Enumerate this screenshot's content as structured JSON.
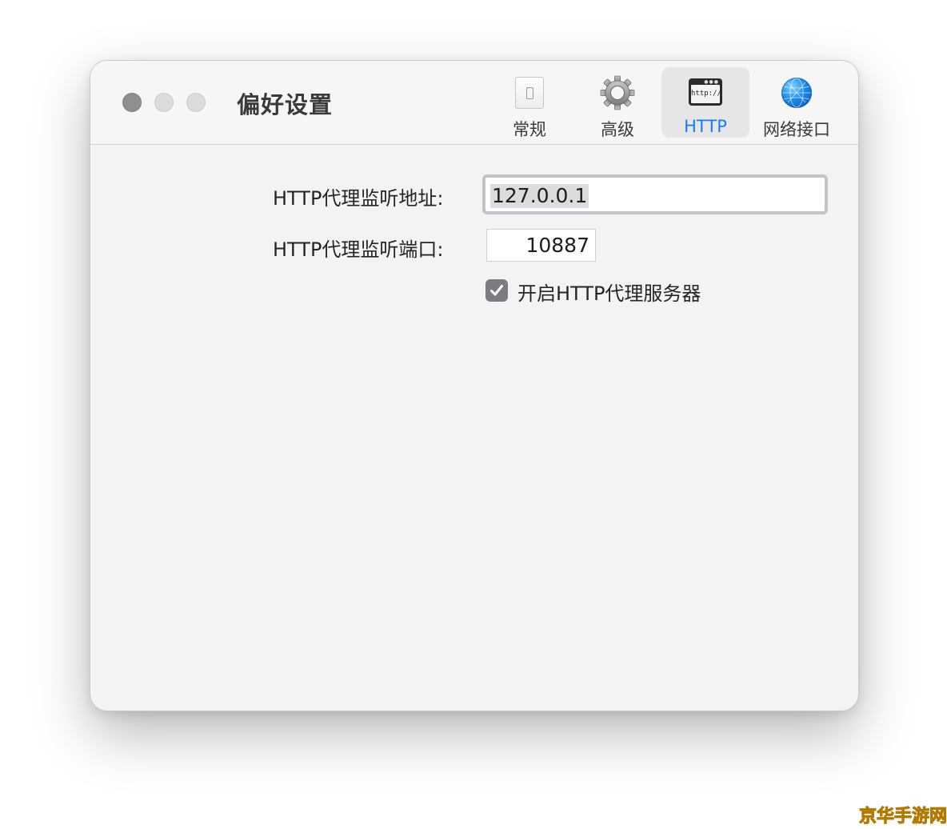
{
  "window": {
    "title": "偏好设置"
  },
  "toolbar": {
    "tabs": [
      {
        "label": "常规",
        "icon": "switch-icon",
        "active": false
      },
      {
        "label": "高级",
        "icon": "gear-icon",
        "active": false
      },
      {
        "label": "HTTP",
        "icon": "http-window-icon",
        "active": true,
        "icon_text": "http://"
      },
      {
        "label": "网络接口",
        "icon": "globe-icon",
        "active": false
      }
    ],
    "active_color": "#1a7bf2"
  },
  "http": {
    "address_label": "HTTP代理监听地址:",
    "address_value": "127.0.0.1",
    "port_label": "HTTP代理监听端口:",
    "port_value": "10887",
    "enable_label": "开启HTTP代理服务器",
    "enable_checked": true
  },
  "watermark": {
    "text": "京华手游网"
  }
}
